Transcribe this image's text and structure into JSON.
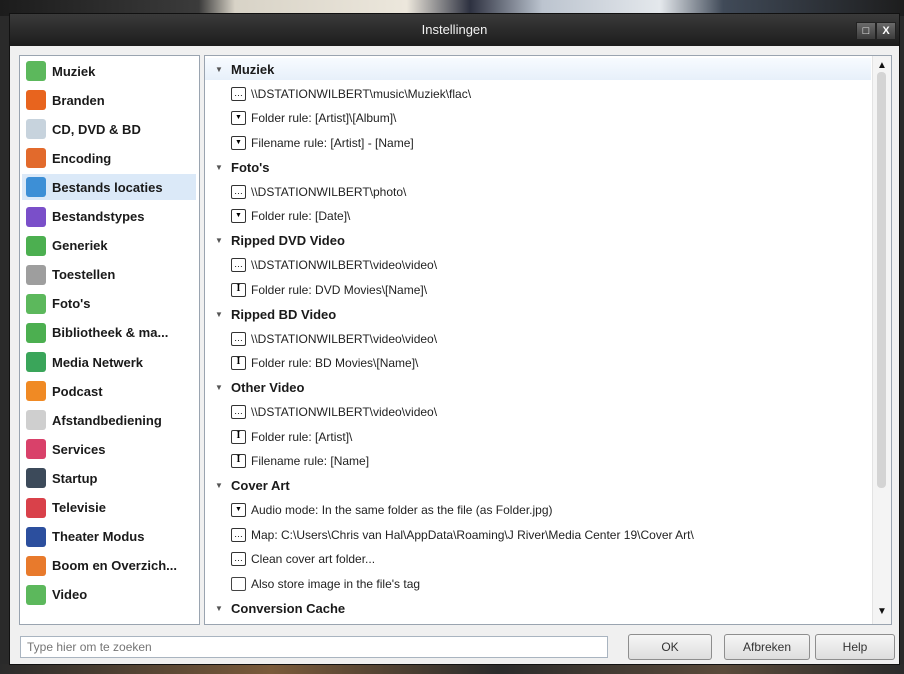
{
  "window": {
    "title": "Instellingen",
    "maximize_glyph": "□",
    "close_glyph": "X"
  },
  "sidebar": {
    "items": [
      {
        "label": "Muziek",
        "icon": "music-icon",
        "color": "#5cb85c"
      },
      {
        "label": "Branden",
        "icon": "burn-flame-icon",
        "color": "#e8641e"
      },
      {
        "label": "CD, DVD & BD",
        "icon": "disc-icon",
        "color": "#c7d3dd"
      },
      {
        "label": "Encoding",
        "icon": "encoding-icon",
        "color": "#e26a2c"
      },
      {
        "label": "Bestands locaties",
        "icon": "globe-icon",
        "color": "#3d8fd6",
        "selected": true
      },
      {
        "label": "Bestandstypes",
        "icon": "puzzle-icon",
        "color": "#7a4fc9"
      },
      {
        "label": "Generiek",
        "icon": "check-icon",
        "color": "#4caf50"
      },
      {
        "label": "Toestellen",
        "icon": "device-icon",
        "color": "#9e9e9e"
      },
      {
        "label": "Foto's",
        "icon": "photo-icon",
        "color": "#5cb85c"
      },
      {
        "label": "Bibliotheek & ma...",
        "icon": "library-icon",
        "color": "#4caf50"
      },
      {
        "label": "Media Netwerk",
        "icon": "network-icon",
        "color": "#3aa55a"
      },
      {
        "label": "Podcast",
        "icon": "rss-icon",
        "color": "#f08a24"
      },
      {
        "label": "Afstandbediening",
        "icon": "remote-icon",
        "color": "#cfcfcf"
      },
      {
        "label": "Services",
        "icon": "services-icon",
        "color": "#d9416a"
      },
      {
        "label": "Startup",
        "icon": "startup-icon",
        "color": "#3c4a5a"
      },
      {
        "label": "Televisie",
        "icon": "tv-icon",
        "color": "#d9414a"
      },
      {
        "label": "Theater Modus",
        "icon": "theater-icon",
        "color": "#2c4f9e"
      },
      {
        "label": "Boom en Overzich...",
        "icon": "tree-icon",
        "color": "#e87a2c"
      },
      {
        "label": "Video",
        "icon": "video-icon",
        "color": "#5cb85c"
      }
    ]
  },
  "content": {
    "sections": [
      {
        "header": "Muziek",
        "rows": [
          {
            "control": "browse",
            "text": "\\\\DSTATIONWILBERT\\music\\Muziek\\flac\\"
          },
          {
            "control": "dropdown",
            "text": "Folder rule: [Artist]\\[Album]\\"
          },
          {
            "control": "dropdown",
            "text": "Filename rule: [Artist] - [Name]"
          }
        ]
      },
      {
        "header": "Foto's",
        "rows": [
          {
            "control": "browse",
            "text": "\\\\DSTATIONWILBERT\\photo\\"
          },
          {
            "control": "dropdown",
            "text": "Folder rule: [Date]\\"
          }
        ]
      },
      {
        "header": "Ripped DVD Video",
        "rows": [
          {
            "control": "browse",
            "text": "\\\\DSTATIONWILBERT\\video\\video\\"
          },
          {
            "control": "edit",
            "text": "Folder rule: DVD Movies\\[Name]\\"
          }
        ]
      },
      {
        "header": "Ripped BD Video",
        "rows": [
          {
            "control": "browse",
            "text": "\\\\DSTATIONWILBERT\\video\\video\\"
          },
          {
            "control": "edit",
            "text": "Folder rule: BD Movies\\[Name]\\"
          }
        ]
      },
      {
        "header": "Other Video",
        "rows": [
          {
            "control": "browse",
            "text": "\\\\DSTATIONWILBERT\\video\\video\\"
          },
          {
            "control": "edit",
            "text": "Folder rule: [Artist]\\"
          },
          {
            "control": "edit",
            "text": "Filename rule: [Name]"
          }
        ]
      },
      {
        "header": "Cover Art",
        "rows": [
          {
            "control": "dropdown",
            "text": "Audio mode: In the same folder as the file (as Folder.jpg)"
          },
          {
            "control": "browse",
            "text": "Map: C:\\Users\\Chris van Hal\\AppData\\Roaming\\J River\\Media Center 19\\Cover Art\\"
          },
          {
            "control": "browse",
            "text": "Clean cover art folder..."
          },
          {
            "control": "checkbox",
            "text": "Also store image in the file's tag",
            "checked": false
          }
        ]
      },
      {
        "header": "Conversion Cache",
        "rows": []
      }
    ],
    "glyphs": {
      "caret": "▼",
      "browse": "…",
      "dropdown": "▼",
      "edit": "I",
      "checkbox": "",
      "scroll_up": "▲",
      "scroll_down": "▼"
    }
  },
  "footer": {
    "search_placeholder": "Type hier om te zoeken",
    "ok_label": "OK",
    "cancel_label": "Afbreken",
    "help_label": "Help"
  }
}
